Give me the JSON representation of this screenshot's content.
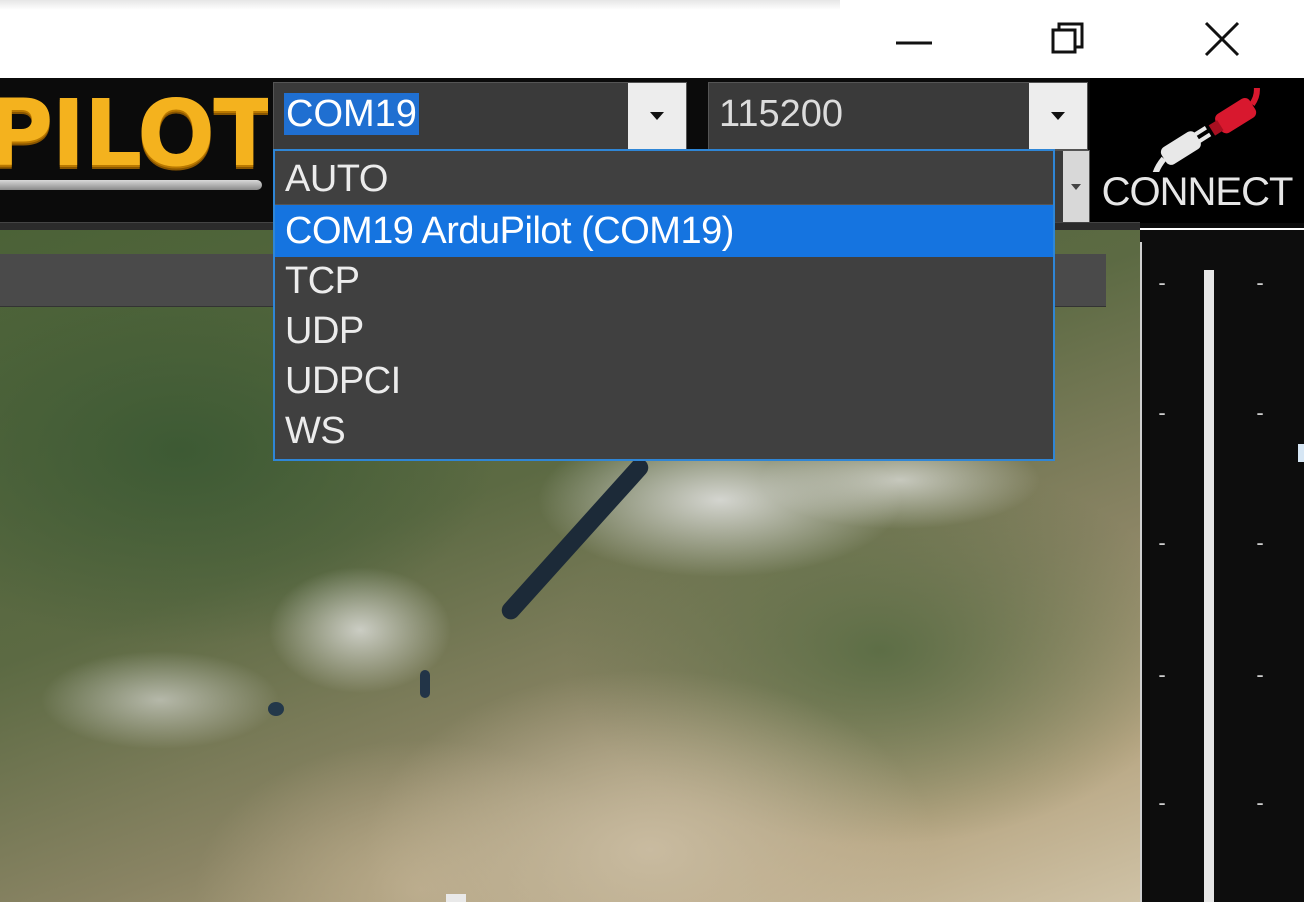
{
  "window": {
    "controls": {
      "minimize_icon": "minimize-icon",
      "maximize_icon": "restore-icon",
      "close_icon": "close-icon"
    }
  },
  "logo": {
    "text": "PILOT"
  },
  "port_combo": {
    "value": "COM19",
    "options": [
      "AUTO",
      "COM19 ArduPilot (COM19)",
      "TCP",
      "UDP",
      "UDPCI",
      "WS"
    ],
    "highlighted_index": 1
  },
  "baud_combo": {
    "value": "115200"
  },
  "connect": {
    "label": "CONNECT",
    "icon": "plug-connect-icon"
  },
  "hud": {
    "ticks": [
      "-",
      "-",
      "-",
      "-",
      "-",
      "-",
      "-",
      "-",
      "-",
      "-"
    ]
  },
  "colors": {
    "toolbar_bg": "#0b0b0b",
    "selection": "#1574e0",
    "dropdown_border": "#2f86d6",
    "logo": "#f4b21e"
  }
}
